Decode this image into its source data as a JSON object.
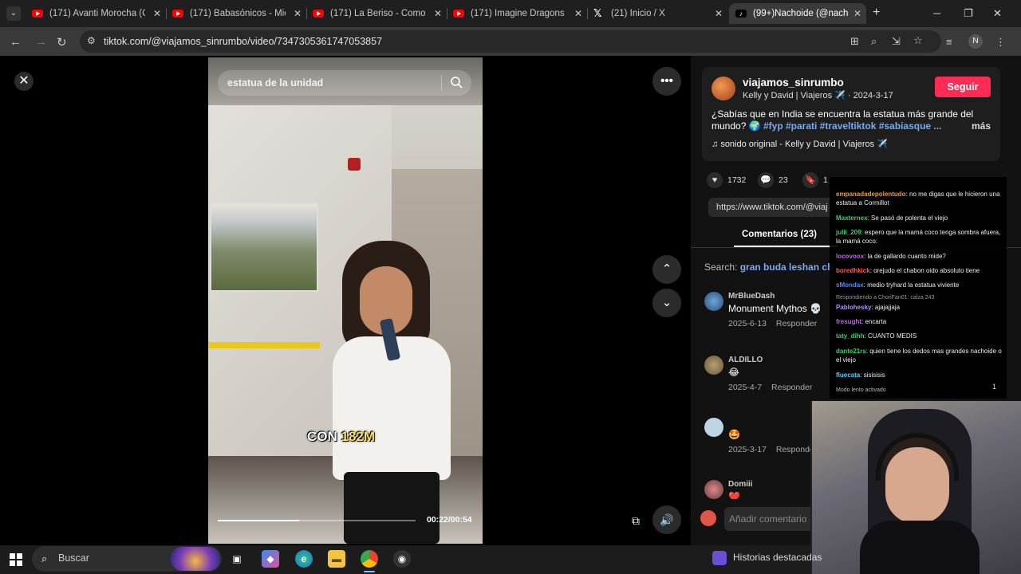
{
  "tabs": [
    {
      "label": "(171) Avanti Morocha (CAE",
      "icon": "youtube-icon"
    },
    {
      "label": "(171) Babasónicos - Micro",
      "icon": "youtube-icon"
    },
    {
      "label": "(171) La Beriso - Como Ol",
      "icon": "youtube-icon"
    },
    {
      "label": "(171) Imagine Dragons - R",
      "icon": "youtube-icon"
    },
    {
      "label": "(21) Inicio / X",
      "icon": "x-icon"
    },
    {
      "label": "(99+)Nachoide (@nachoid",
      "icon": "tiktok-icon",
      "active": true
    }
  ],
  "browser": {
    "url": "tiktok.com/@viajamos_sinrumbo/video/7347305361747053857",
    "profile_initial": "N"
  },
  "video": {
    "search_text": "estatua de la unidad",
    "caption_prefix": "CON ",
    "caption_highlight": "182M",
    "time": "00:22/00:54",
    "progress": 0.41
  },
  "post": {
    "username": "viajamos_sinrumbo",
    "nickname": "Kelly y David | Viajeros ✈️",
    "date": "2024-3-17",
    "follow_label": "Seguir",
    "description": "¿Sabías que en India se encuentra la estatua más grande del mundo? 🌍",
    "tags": "#fyp #parati #traveltiktok #sabiasque ...",
    "more_label": "más",
    "music": "sonido original - Kelly y David | Viajeros ✈️",
    "likes": "1732",
    "comments": "23",
    "saves": "1",
    "link": "https://www.tiktok.com/@viaj",
    "comments_tab": "Comentarios (23)",
    "search_prefix": "Search:",
    "search_term": "gran buda leshan ch",
    "add_comment_placeholder": "Añadir comentario"
  },
  "comments": [
    {
      "user": "MrBlueDash",
      "text": "Monument Mythos 💀",
      "date": "2025-6-13",
      "reply": "Responder"
    },
    {
      "user": "ALDILLO",
      "text": "😂",
      "date": "2025-4-7",
      "reply": "Responder"
    },
    {
      "user": "",
      "text": "🤩",
      "date": "2025-3-17",
      "reply": "Responder"
    },
    {
      "user": "Domiii",
      "text": "❤️",
      "date": "",
      "reply": ""
    }
  ],
  "chat": [
    {
      "user": "empanadadepolentudo",
      "text": "no me digas que le hicieron una estatua a Cormillot",
      "color": "#f29a37"
    },
    {
      "user": "Maxternex",
      "text": "Se pasó de polenta el viejo",
      "color": "#3ccf6b"
    },
    {
      "user": "julii_209",
      "text": "espero que la mamá coco tenga sombra afuera, la mamá coco:",
      "color": "#3ccf6b"
    },
    {
      "user": "locovoox",
      "text": "la de gallardo cuanto mide?",
      "color": "#c062f0"
    },
    {
      "user": "boredhkick",
      "text": "orejudo el chabon oido absoluto tiene",
      "color": "#ff5a5a"
    },
    {
      "user": "sMondax",
      "text": "medio tryhard la estatua viviente",
      "color": "#4f8cff"
    },
    {
      "user": "",
      "text": "Respondiendo a ChoriFan01: calza 243",
      "color": "#999999"
    },
    {
      "user": "Pablohesky",
      "text": "ajajajjaja",
      "color": "#b58cff"
    },
    {
      "user": "fresught",
      "text": "encarta",
      "color": "#c062f0"
    },
    {
      "user": "taty_dihh",
      "text": "CUANTO MEDIS",
      "color": "#3ccf6b"
    },
    {
      "user": "dante21rs",
      "text": "quien tiene los dedos mas grandes nachoide o el viejo",
      "color": "#3ccf6b"
    },
    {
      "user": "fluecata",
      "text": "sisisisis",
      "color": "#4fd4ff"
    }
  ],
  "chat_slow_mode": "Modo lento activado",
  "chat_counter": "1",
  "taskbar": {
    "search_placeholder": "Buscar",
    "widget_label": "Historias destacadas"
  },
  "colors": {
    "follow": "#fe2c55",
    "hashtag": "#7aaaf0",
    "caption_highlight": "#fde24b",
    "bookmark": "#f5c518"
  }
}
